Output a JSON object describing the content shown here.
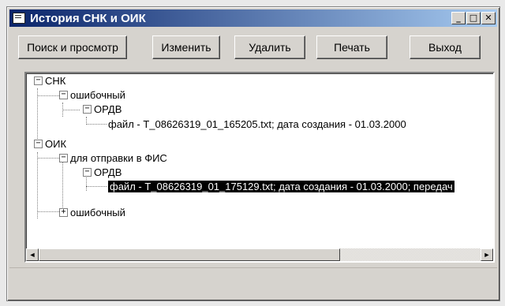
{
  "window": {
    "title": "История СНК и ОИК",
    "controls": {
      "minimize": "_",
      "maximize": "□",
      "close": "✕"
    }
  },
  "toolbar": {
    "buttons": [
      {
        "label": "Поиск и просмотр"
      },
      {
        "label": "Изменить"
      },
      {
        "label": "Удалить"
      },
      {
        "label": "Печать"
      },
      {
        "label": "Выход"
      }
    ]
  },
  "tree": {
    "snk": {
      "label": "СНК",
      "expanded": true,
      "child": {
        "label": "ошибочный",
        "expanded": true,
        "child": {
          "label": "ОРДВ",
          "expanded": true,
          "file": "файл - T_08626319_01_165205.txt; дата создания - 01.03.2000"
        }
      }
    },
    "oik": {
      "label": "ОИК",
      "expanded": true,
      "child": {
        "label": "для отправки в ФИС",
        "expanded": true,
        "child": {
          "label": "ОРДВ",
          "expanded": true,
          "file": "файл - T_08626319_01_175129.txt; дата создания - 01.03.2000; передач"
        }
      },
      "child2": {
        "label": "ошибочный",
        "expanded": false
      }
    }
  },
  "scrollbar": {
    "left_arrow": "◄",
    "right_arrow": "►"
  }
}
